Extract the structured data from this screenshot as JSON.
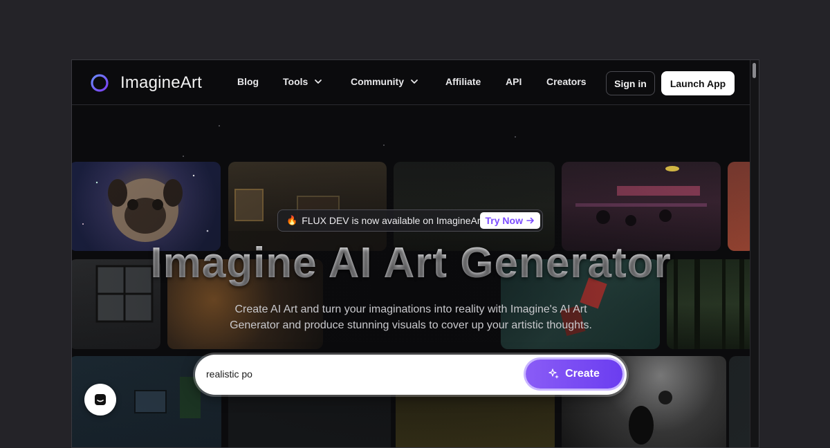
{
  "brand": {
    "name": "ImagineArt",
    "logo_icon": "ring-logo-icon",
    "accent_color": "#7b4bff"
  },
  "nav": {
    "items": [
      {
        "label": "Blog",
        "has_dropdown": false
      },
      {
        "label": "Tools",
        "has_dropdown": true
      },
      {
        "label": "Community",
        "has_dropdown": true
      },
      {
        "label": "Affiliate",
        "has_dropdown": false
      },
      {
        "label": "API",
        "has_dropdown": false
      },
      {
        "label": "Creators",
        "has_dropdown": false
      }
    ],
    "signin_label": "Sign in",
    "launch_label": "Launch App"
  },
  "hero": {
    "announcement": {
      "icon": "fire-emoji",
      "text": "FLUX DEV is now available on ImagineArt",
      "cta": "Try Now"
    },
    "title": "Imagine AI Art Generator",
    "subtitle": "Create AI Art and turn your imaginations into reality with Imagine's AI Art Generator and produce stunning visuals to cover up your artistic thoughts.",
    "prompt": {
      "value": "realistic po",
      "button_label": "Create",
      "button_icon": "sparkles-icon"
    }
  },
  "chat_widget": {
    "icon": "chat-icon"
  }
}
